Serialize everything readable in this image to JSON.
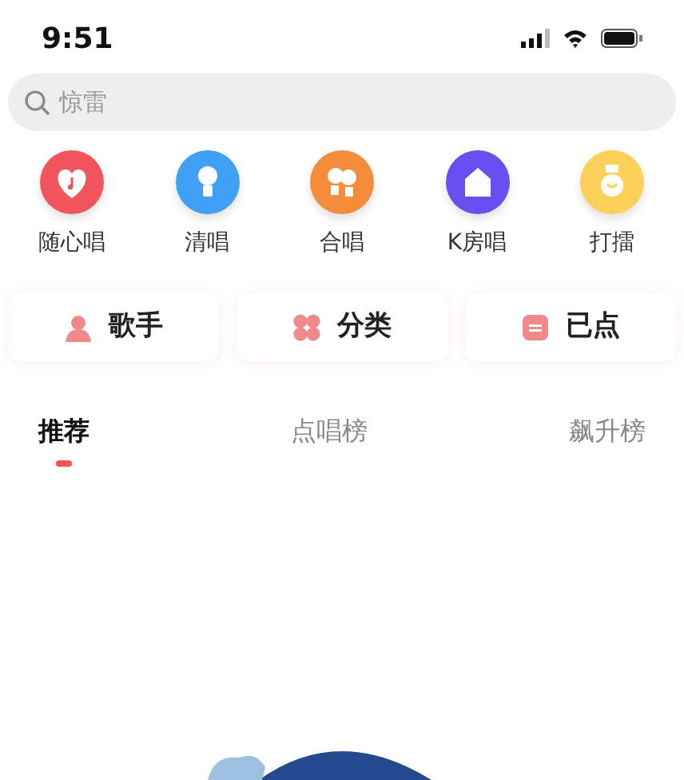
{
  "status_bar": {
    "time": "9:51"
  },
  "search": {
    "placeholder": "惊雷"
  },
  "features": [
    {
      "label": "随心唱",
      "kind": "heart",
      "color": "#f2545b"
    },
    {
      "label": "清唱",
      "kind": "mic",
      "color": "#3fa0f5"
    },
    {
      "label": "合唱",
      "kind": "duet",
      "color": "#f58c3c"
    },
    {
      "label": "K房唱",
      "kind": "room",
      "color": "#6a4ff0"
    },
    {
      "label": "打擂",
      "kind": "medal",
      "color": "#fdd05a"
    }
  ],
  "shortcuts": [
    {
      "label": "歌手",
      "kind": "singer"
    },
    {
      "label": "分类",
      "kind": "category"
    },
    {
      "label": "已点",
      "kind": "queue"
    }
  ],
  "tabs": [
    {
      "label": "推荐",
      "selected": true
    },
    {
      "label": "点唱榜",
      "selected": false
    },
    {
      "label": "飙升榜",
      "selected": false
    }
  ]
}
